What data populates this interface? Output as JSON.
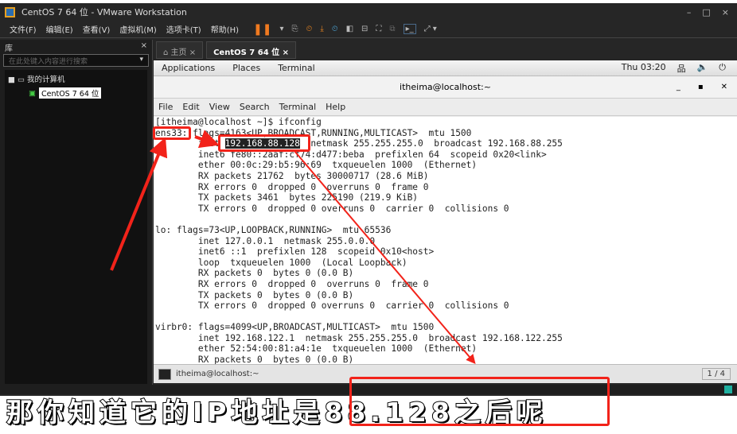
{
  "window": {
    "title": "CentOS 7 64 位 - VMware Workstation",
    "controls": [
      "–",
      "□",
      "×"
    ]
  },
  "menu": [
    "文件(F)",
    "编辑(E)",
    "查看(V)",
    "虚拟机(M)",
    "选项卡(T)",
    "帮助(H)"
  ],
  "library": {
    "title": "库",
    "close": "×",
    "search_placeholder": "在此处键入内容进行搜索",
    "root": "我的计算机",
    "vm": "CentOS 7 64 位"
  },
  "tabs": [
    {
      "label": "⌂ 主页 ×"
    },
    {
      "label": "CentOS 7 64 位 ×"
    }
  ],
  "gnome": {
    "applications": "Applications",
    "places": "Places",
    "terminal": "Terminal",
    "clock": "Thu 03:20"
  },
  "terminal": {
    "title": "itheima@localhost:~",
    "menu": [
      "File",
      "Edit",
      "View",
      "Search",
      "Terminal",
      "Help"
    ],
    "prompt": "[itheima@localhost ~]$ ifconfig",
    "ens_label": "ens33:",
    "ens_flags": " flags=4163<UP,BROADCAST,RUNNING,MULTICAST>  mtu 1500",
    "inet_prefix": "        inet ",
    "ip": "192.168.88.128",
    "inet_rest": "  netmask 255.255.255.0  broadcast 192.168.88.255",
    "lines": [
      "        inet6 fe80::2aaf:cf74:d477:beba  prefixlen 64  scopeid 0x20<link>",
      "        ether 00:0c:29:b5:96:69  txqueuelen 1000  (Ethernet)",
      "        RX packets 21762  bytes 30000717 (28.6 MiB)",
      "        RX errors 0  dropped 0  overruns 0  frame 0",
      "        TX packets 3461  bytes 225190 (219.9 KiB)",
      "        TX errors 0  dropped 0 overruns 0  carrier 0  collisions 0",
      "",
      "lo: flags=73<UP,LOOPBACK,RUNNING>  mtu 65536",
      "        inet 127.0.0.1  netmask 255.0.0.0",
      "        inet6 ::1  prefixlen 128  scopeid 0x10<host>",
      "        loop  txqueuelen 1000  (Local Loopback)",
      "        RX packets 0  bytes 0 (0.0 B)",
      "        RX errors 0  dropped 0  overruns 0  frame 0",
      "        TX packets 0  bytes 0 (0.0 B)",
      "        TX errors 0  dropped 0 overruns 0  carrier 0  collisions 0",
      "",
      "virbr0: flags=4099<UP,BROADCAST,MULTICAST>  mtu 1500",
      "        inet 192.168.122.1  netmask 255.255.255.0  broadcast 192.168.122.255",
      "        ether 52:54:00:81:a4:1e  txqueuelen 1000  (Ethernet)",
      "        RX packets 0  bytes 0 (0.0 B)"
    ]
  },
  "taskbar": {
    "item": "itheima@localhost:~",
    "page": "1 / 4"
  },
  "subtitle": "那你知道它的IP地址是88.128之后呢",
  "colors": {
    "annotation": "#f2231a"
  }
}
